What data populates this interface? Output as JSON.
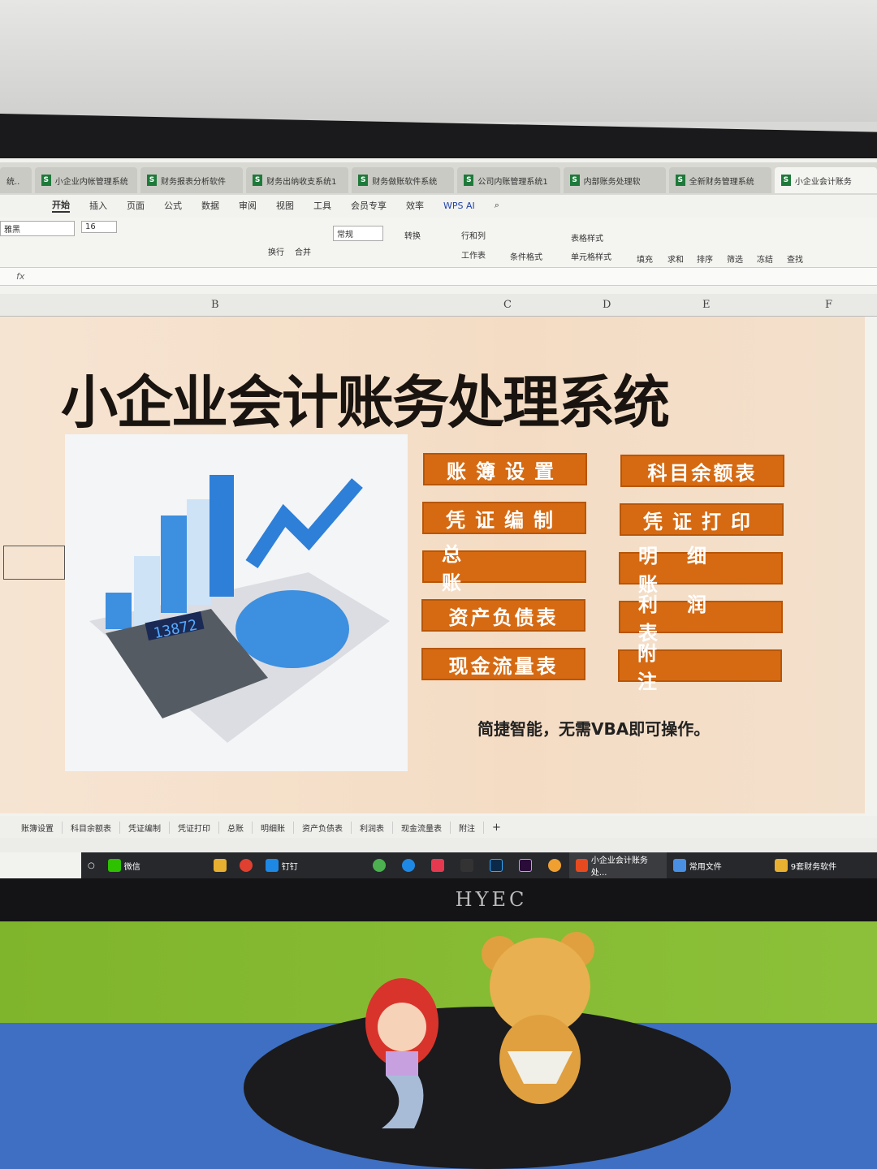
{
  "window_tabs": [
    "小企业内帐管理系统",
    "财务报表分析软件",
    "财务出纳收支系统1",
    "财务做账软件系统",
    "公司内账管理系统1",
    "内部账务处理软",
    "全新财务管理系统",
    "小企业会计账务"
  ],
  "menu": [
    "开始",
    "插入",
    "页面",
    "公式",
    "数据",
    "审阅",
    "视图",
    "工具",
    "会员专享",
    "效率",
    "WPS AI"
  ],
  "ribbon": {
    "font_name": "雅黑",
    "font_size": "16",
    "number_format": "常规",
    "convert": "转换",
    "row_col": "行和列",
    "worksheet": "工作表",
    "cond_format": "条件格式",
    "table_style": "表格样式",
    "cell_style": "单元格样式",
    "wrap": "换行",
    "merge": "合并",
    "fill": "填充",
    "sum": "求和",
    "sort": "排序",
    "filter": "筛选",
    "freeze": "冻结",
    "find": "查找"
  },
  "formula_bar": {
    "fx": "fx"
  },
  "columns": [
    "B",
    "C",
    "D",
    "E",
    "F"
  ],
  "content": {
    "title": "小企业会计账务处理系统",
    "buttons_left": [
      "账簿设置",
      "凭证编制",
      "总账",
      "资产负债表",
      "现金流量表"
    ],
    "buttons_right": [
      "科目余额表",
      "凭证打印",
      "明细账",
      "利润表",
      "附注"
    ],
    "slogan": "简捷智能，无需VBA即可操作。",
    "calculator_display": "13872",
    "accent_color": "#d66a12"
  },
  "sheet_tabs": [
    "账簿设置",
    "科目余额表",
    "凭证编制",
    "凭证打印",
    "总账",
    "明细账",
    "资产负债表",
    "利润表",
    "现金流量表",
    "附注",
    "+"
  ],
  "taskbar": [
    {
      "label": "微信"
    },
    {
      "label": "钉钉"
    },
    {
      "label": "小企业会计账务处..."
    },
    {
      "label": "常用文件"
    },
    {
      "label": "9套财务软件"
    }
  ],
  "monitor_brand": "HYEC"
}
